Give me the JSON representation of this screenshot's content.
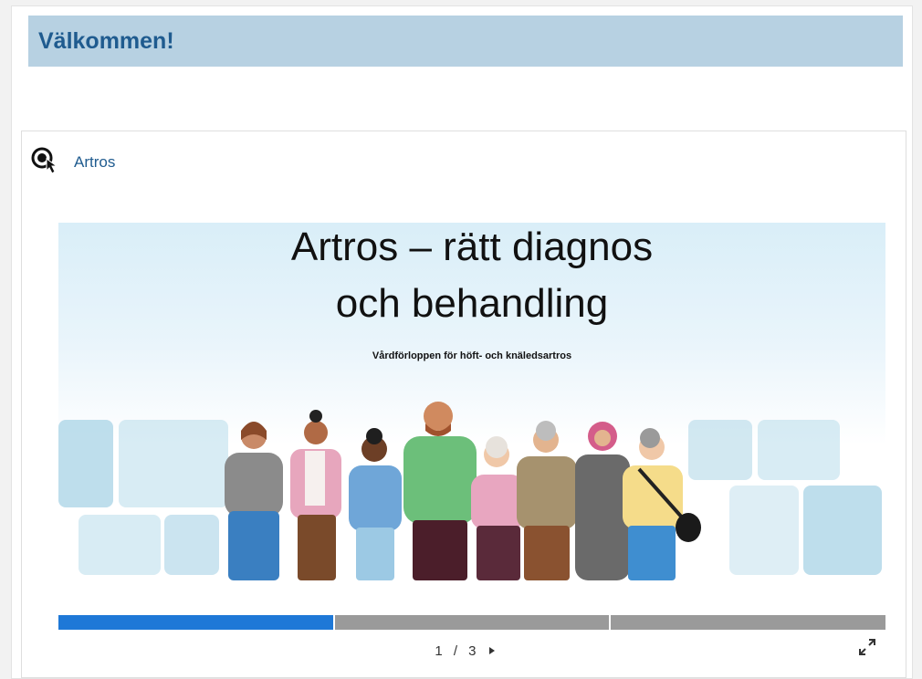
{
  "header": {
    "title": "Välkommen!"
  },
  "activity": {
    "icon": "interactive-content-icon",
    "link_label": "Artros"
  },
  "slide": {
    "title_line1": "Artros – rätt diagnos",
    "title_line2": "och behandling",
    "subtitle": "Vårdförloppen för höft- och knäledsartros",
    "illustration": "group-of-people-illustration"
  },
  "presentation": {
    "current_slide": 1,
    "total_slides": 3,
    "counter_separator": "/",
    "progress_fraction": 0.333
  },
  "icons": {
    "next": "next-slide-icon",
    "fullscreen": "fullscreen-icon"
  },
  "colors": {
    "header_bg": "#b7d1e2",
    "header_text": "#1f5b8f",
    "link": "#1f5b8f",
    "progress_active": "#1e78d7",
    "progress_inactive": "#9a9a9a"
  }
}
